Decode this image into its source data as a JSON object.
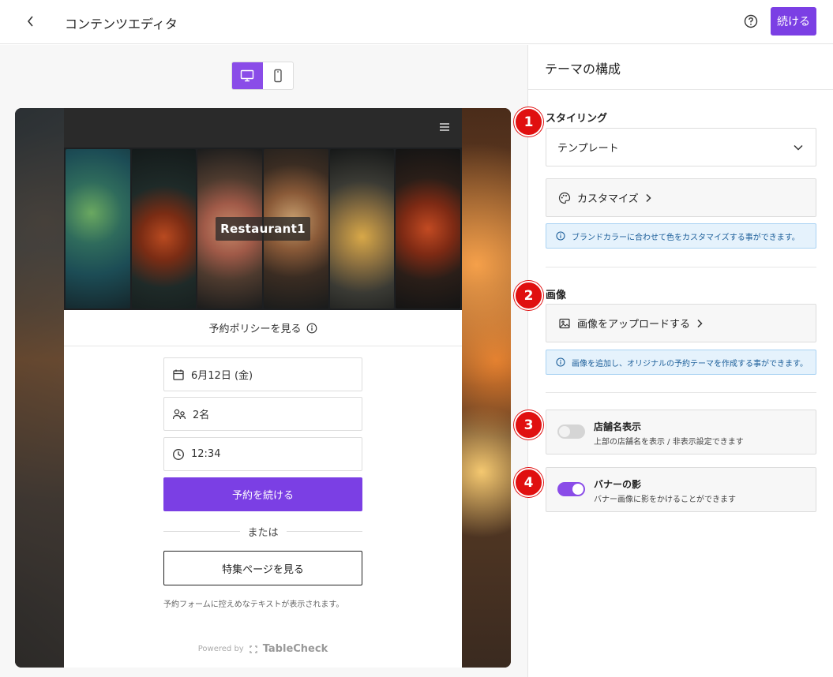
{
  "header": {
    "title": "コンテンツエディタ",
    "continue_label": "続ける"
  },
  "preview": {
    "restaurant_name": "Restaurant1",
    "policy_link": "予約ポリシーを見る",
    "date_value": "6月12日 (金)",
    "party_value": "2名",
    "time_value": "12:34",
    "primary_button": "予約を続ける",
    "or_text": "または",
    "secondary_button": "特集ページを見る",
    "footnote": "予約フォームに控えめなテキストが表示されます。",
    "powered_by": "Powered by",
    "brand": "TableCheck"
  },
  "panel": {
    "title": "テーマの構成",
    "styling": {
      "badge": "1",
      "heading": "スタイリング",
      "template_value": "テンプレート",
      "customize_label": "カスタマイズ",
      "info": "ブランドカラーに合わせて色をカスタマイズする事ができます。"
    },
    "image": {
      "badge": "2",
      "heading": "画像",
      "upload_label": "画像をアップロードする",
      "info": "画像を追加し、オリジナルの予約テーマを作成する事ができます。"
    },
    "store_name_toggle": {
      "badge": "3",
      "title": "店舗名表示",
      "description": "上部の店舗名を表示 / 非表示設定できます",
      "on": false
    },
    "banner_shadow_toggle": {
      "badge": "4",
      "title": "バナーの影",
      "description": "バナー画像に影をかけることができます",
      "on": true
    }
  },
  "colors": {
    "accent": "#7b3fe4",
    "badge": "#e01010",
    "info_bg": "#e5f2fc",
    "info_text": "#1d5f9a"
  }
}
